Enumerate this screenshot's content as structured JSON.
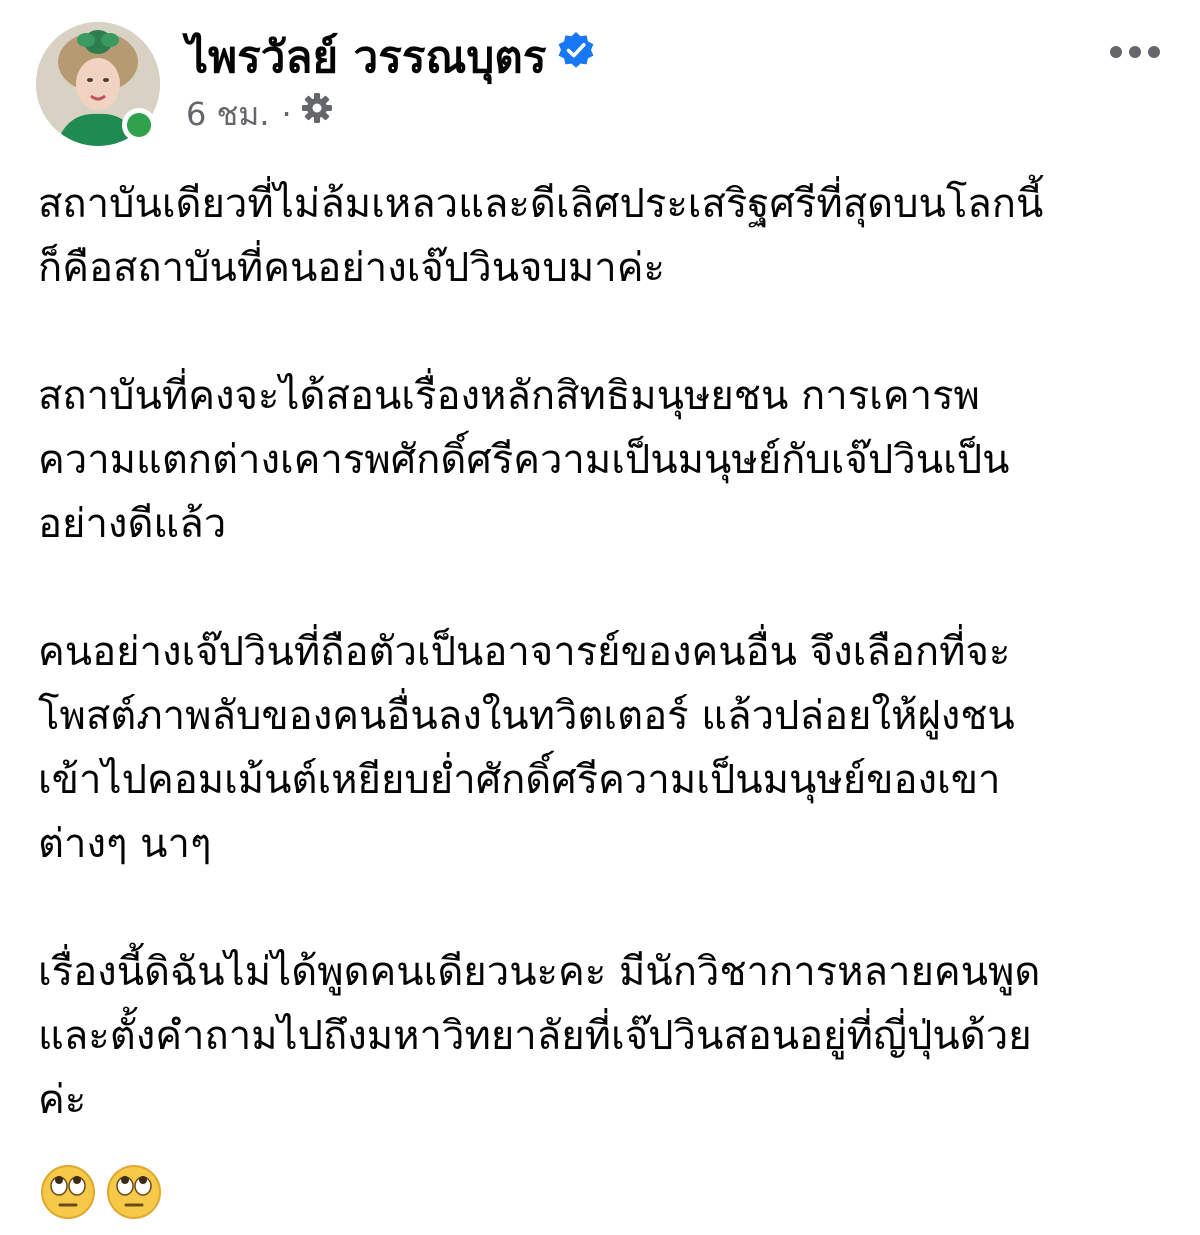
{
  "post": {
    "author": "ไพรวัลย์ วรรณบุตร",
    "time": "6 ชม.",
    "separator": "·",
    "icons": {
      "verified": "verified-badge-icon",
      "audience": "gear-icon",
      "more": "more-options-icon",
      "online": "online-status-dot"
    },
    "colors": {
      "verified_blue": "#1877f2",
      "online_green": "#31a24c",
      "meta_gray": "#65676b"
    },
    "paragraphs": [
      {
        "lines": [
          "สถาบันเดียวที่ไม่ล้มเหลวและดีเลิศประเสริฐศรีที่สุดบนโลกนี้",
          "ก็คือสถาบันที่คนอย่างเจ๊ปวินจบมาค่ะ"
        ]
      },
      {
        "lines": [
          "สถาบันที่คงจะได้สอนเรื่องหลักสิทธิมนุษยชน การเคารพ",
          "ความแตกต่างเคารพศักดิ์ศรีความเป็นมนุษย์กับเจ๊ปวินเป็น",
          "อย่างดีแล้ว"
        ]
      },
      {
        "lines": [
          "คนอย่างเจ๊ปวินที่ถือตัวเป็นอาจารย์ของคนอื่น จึงเลือกที่จะ",
          "โพสต์ภาพลับของคนอื่นลงในทวิตเตอร์  แล้วปล่อยให้ฝูงชน",
          "เข้าไปคอมเม้นต์เหยียบย่ำศักดิ์ศรีความเป็นมนุษย์ของเขา",
          "ต่างๆ นาๆ"
        ]
      },
      {
        "lines": [
          "เรื่องนี้ดิฉันไม่ได้พูดคนเดียวนะคะ มีนักวิชาการหลายคนพูด",
          "และตั้งคำถามไปถึงมหาวิทยาลัยที่เจ๊ปวินสอนอยู่ที่ญี่ปุ่นด้วย",
          "ค่ะ"
        ]
      }
    ],
    "emojis": [
      "face-with-rolling-eyes-emoji",
      "face-with-rolling-eyes-emoji"
    ]
  }
}
